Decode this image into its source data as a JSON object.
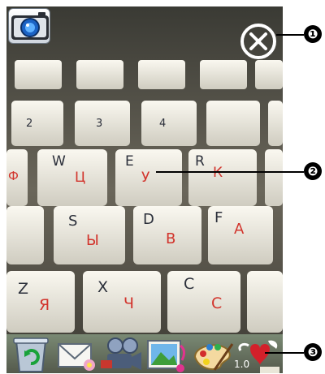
{
  "viewfinder": {
    "keys": [
      {
        "latin": "W",
        "cyr": "Ц"
      },
      {
        "latin": "E",
        "cyr": "У"
      },
      {
        "latin": "R",
        "cyr": "К"
      },
      {
        "latin": "S",
        "cyr": "Ы"
      },
      {
        "latin": "D",
        "cyr": "В"
      },
      {
        "latin": "F",
        "cyr": "А"
      },
      {
        "latin": "Z",
        "cyr": "Я"
      },
      {
        "latin": "X",
        "cyr": "Ч"
      },
      {
        "latin": "C",
        "cyr": "С"
      },
      {
        "latin": "Ф",
        "cyr": ""
      },
      {
        "latin": "2",
        "cyr": ""
      },
      {
        "latin": "3",
        "cyr": ""
      },
      {
        "latin": "4",
        "cyr": ""
      }
    ]
  },
  "top_left_button": {
    "icon": "camera-icon"
  },
  "top_right_button": {
    "icon": "close-icon"
  },
  "toolbar": {
    "items": [
      {
        "icon": "recycle-icon"
      },
      {
        "icon": "mail-envelope-icon"
      },
      {
        "icon": "video-camera-icon"
      },
      {
        "icon": "picture-frame-icon"
      },
      {
        "icon": "paint-palette-icon"
      },
      {
        "icon": "heart-bird-icon"
      }
    ],
    "partial_text": "1.0"
  },
  "callouts": [
    "❶",
    "❷",
    "❸"
  ],
  "colors": {
    "key_cap": "#f1efe6",
    "cyrillic": "#d2342c",
    "latin": "#2b2f3a",
    "callout": "#000000"
  }
}
